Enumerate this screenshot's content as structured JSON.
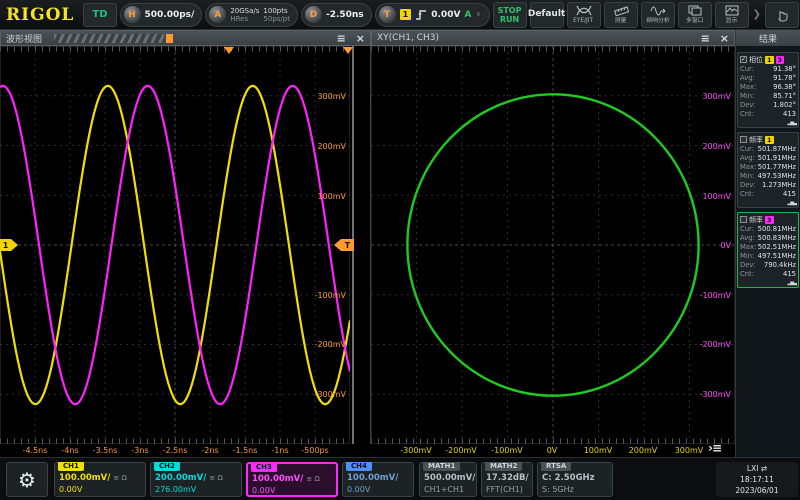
{
  "topbar": {
    "logo": "RIGOL",
    "mode_label": "TD",
    "horizontal": {
      "letter": "H",
      "scale": "500.00ps/"
    },
    "acquire": {
      "letter": "A",
      "sample_rate": "20GSa/s",
      "mode": "HRes",
      "depth": "100pts",
      "resolution": "50ps/pt"
    },
    "delay": {
      "letter": "D",
      "value": "-2.50ns"
    },
    "trigger": {
      "letter": "T",
      "source": "1",
      "level": "0.00V",
      "sweep": "A",
      "chevron": "‹"
    },
    "run_button": {
      "line1": "STOP",
      "line2": "RUN"
    },
    "default_button": "Default",
    "tool_buttons": [
      {
        "icon": "eye-diagram-icon",
        "label": "EYE/JIT"
      },
      {
        "icon": "measure-icon",
        "label": "测量"
      },
      {
        "icon": "bode-icon",
        "label": "频响分析"
      },
      {
        "icon": "multi-window-icon",
        "label": "多窗口"
      },
      {
        "icon": "display-icon",
        "label": "显示"
      }
    ],
    "more_chevron": "❯"
  },
  "waveform_view": {
    "title": "波形视图",
    "menu_icon": "≡",
    "close_icon": "×",
    "trigger_letter": "T",
    "ch1_marker": "1",
    "y_labels": [
      "300mV",
      "200mV",
      "100mV",
      "-100mV",
      "-200mV",
      "-300mV"
    ],
    "x_labels": [
      "-4.5ns",
      "-4ns",
      "-3.5ns",
      "-3ns",
      "-2.5ns",
      "-2ns",
      "-1.5ns",
      "-1ns",
      "-500ps"
    ],
    "axis_color": "#ff9b30",
    "channels": [
      {
        "name": "CH1",
        "color": "#f0e000",
        "amplitude_mV": 320,
        "period_ns": 2.07,
        "peak_time_ns": -3.46
      },
      {
        "name": "CH3",
        "color": "#ff22ff",
        "amplitude_mV": 320,
        "period_ns": 2.07,
        "peak_time_ns": -2.89
      }
    ],
    "volts_per_div": "100mV",
    "time_span_ns": 5
  },
  "xy_view": {
    "title": "XY(CH1, CH3)",
    "menu_icon": "≡",
    "close_icon": "×",
    "corner_menu_icon": "›≡",
    "x_labels": [
      "-300mV",
      "-200mV",
      "-100mV",
      "0V",
      "100mV",
      "200mV",
      "300mV"
    ],
    "y_labels": [
      "300mV",
      "200mV",
      "100mV",
      "0V",
      "-100mV",
      "-200mV",
      "-300mV"
    ],
    "x_axis_color": "#e6d800",
    "y_axis_color": "#ff4dff",
    "trace_color": "#1ecb1e",
    "radius_x_mV": 320,
    "radius_y_mV": 303
  },
  "results": {
    "title": "结果",
    "histogram_icon": "▂▅▃",
    "cards": [
      {
        "name": "相位",
        "checked": "✓",
        "src1": "1",
        "src1_style": "background:#f2d400;color:#111",
        "src2": "3",
        "src2_style": "background:#ff29ff;color:#111",
        "rows": [
          {
            "label": "Cur:",
            "value": "91.38°"
          },
          {
            "label": "Avg:",
            "value": "91.78°"
          },
          {
            "label": "Max:",
            "value": "96.38°"
          },
          {
            "label": "Min:",
            "value": "85.71°"
          },
          {
            "label": "Dev:",
            "value": "1.802°"
          },
          {
            "label": "Cnt:",
            "value": "413"
          }
        ]
      },
      {
        "name": "频率",
        "checked": "",
        "src1": "1",
        "src1_style": "background:#f2d400;color:#111",
        "src2": "",
        "src2_style": "display:none",
        "rows": [
          {
            "label": "Cur:",
            "value": "501.87MHz"
          },
          {
            "label": "Avg:",
            "value": "501.91MHz"
          },
          {
            "label": "Max:",
            "value": "501.77MHz"
          },
          {
            "label": "Min:",
            "value": "497.53MHz"
          },
          {
            "label": "Dev:",
            "value": "1.273MHz"
          },
          {
            "label": "Cnt:",
            "value": "415"
          }
        ]
      },
      {
        "name": "频率",
        "checked": "",
        "src1": "3",
        "src1_style": "background:#ff29ff;color:#111",
        "src2": "",
        "src2_style": "display:none",
        "rows": [
          {
            "label": "Cur:",
            "value": "500.81MHz"
          },
          {
            "label": "Avg:",
            "value": "500.83MHz"
          },
          {
            "label": "Max:",
            "value": "502.51MHz"
          },
          {
            "label": "Min:",
            "value": "497.51MHz"
          },
          {
            "label": "Dev:",
            "value": "790.4kHz"
          },
          {
            "label": "Cnt:",
            "value": "415"
          }
        ]
      }
    ]
  },
  "bottombar": {
    "gear_icon": "⚙",
    "coupling_icon": "≡",
    "impedance_icon": "Ω",
    "channels": [
      {
        "tab": "CH1",
        "scale": "100.00mV/",
        "offset": "0.00V",
        "tab_style": "background:#f0e000;color:#111",
        "text_style": "color:#f0e000",
        "off_style": "color:#f0e000"
      },
      {
        "tab": "CH2",
        "scale": "200.00mV/",
        "offset": "276.00mV",
        "tab_style": "background:#00dcdc;color:#111",
        "text_style": "color:#00dcdc",
        "off_style": "color:#00dcdc"
      },
      {
        "tab": "CH3",
        "scale": "100.00mV/",
        "offset": "0.00V",
        "tab_style": "background:#ff29ff;color:#111",
        "text_style": "color:#ff4dff",
        "off_style": "color:#ff4dff"
      },
      {
        "tab": "CH4",
        "scale": "100.00mV/",
        "offset": "0.00V",
        "tab_style": "background:#4f8fff;color:#111",
        "text_style": "color:#6f9fd8",
        "off_style": "color:#6f9fd8"
      }
    ],
    "math": [
      {
        "tab": "MATH1",
        "line1": "500.00mV/",
        "line2": "CH1+CH1"
      },
      {
        "tab": "MATH2",
        "line1": "17.32dB/",
        "line2": "FFT(CH1)"
      }
    ],
    "rtsa": {
      "tab": "RTSA",
      "line1": "C: 2.50GHz",
      "line2": "S: 5GHz"
    },
    "clock": {
      "lxi": "LXI ⇄",
      "time": "18:17:11",
      "date": "2023/06/01"
    }
  }
}
